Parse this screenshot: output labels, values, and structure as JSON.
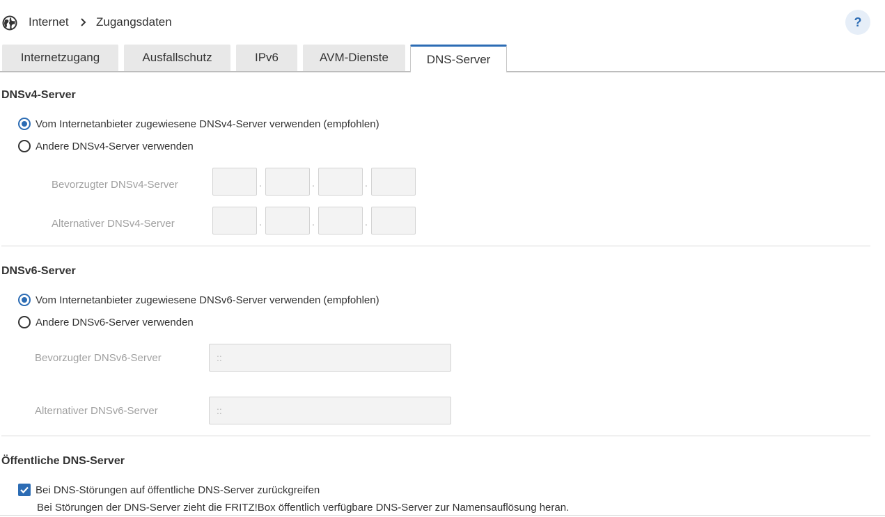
{
  "header": {
    "breadcrumb": [
      "Internet",
      "Zugangsdaten"
    ],
    "help_label": "?"
  },
  "tabs": [
    {
      "label": "Internetzugang",
      "active": false
    },
    {
      "label": "Ausfallschutz",
      "active": false
    },
    {
      "label": "IPv6",
      "active": false
    },
    {
      "label": "AVM-Dienste",
      "active": false
    },
    {
      "label": "DNS-Server",
      "active": true
    }
  ],
  "dnsv4": {
    "title": "DNSv4-Server",
    "option_isp": "Vom Internetanbieter zugewiesene DNSv4-Server verwenden (empfohlen)",
    "option_other": "Andere DNSv4-Server verwenden",
    "selected": "isp",
    "preferred_label": "Bevorzugter DNSv4-Server",
    "alternative_label": "Alternativer DNSv4-Server",
    "separator": "."
  },
  "dnsv6": {
    "title": "DNSv6-Server",
    "option_isp": "Vom Internetanbieter zugewiesene DNSv6-Server verwenden (empfohlen)",
    "option_other": "Andere DNSv6-Server verwenden",
    "selected": "isp",
    "preferred_label": "Bevorzugter DNSv6-Server",
    "preferred_placeholder": "::",
    "alternative_label": "Alternativer DNSv6-Server",
    "alternative_placeholder": "::"
  },
  "public_dns": {
    "title": "Öffentliche DNS-Server",
    "checkbox_label": "Bei DNS-Störungen auf öffentliche DNS-Server zurückgreifen",
    "checked": true,
    "hint": "Bei Störungen der DNS-Server zieht die FRITZ!Box öffentlich verfügbare DNS-Server zur Namensauflösung heran."
  },
  "colors": {
    "accent": "#2c6cb4",
    "help_bg": "#e6eef8"
  }
}
